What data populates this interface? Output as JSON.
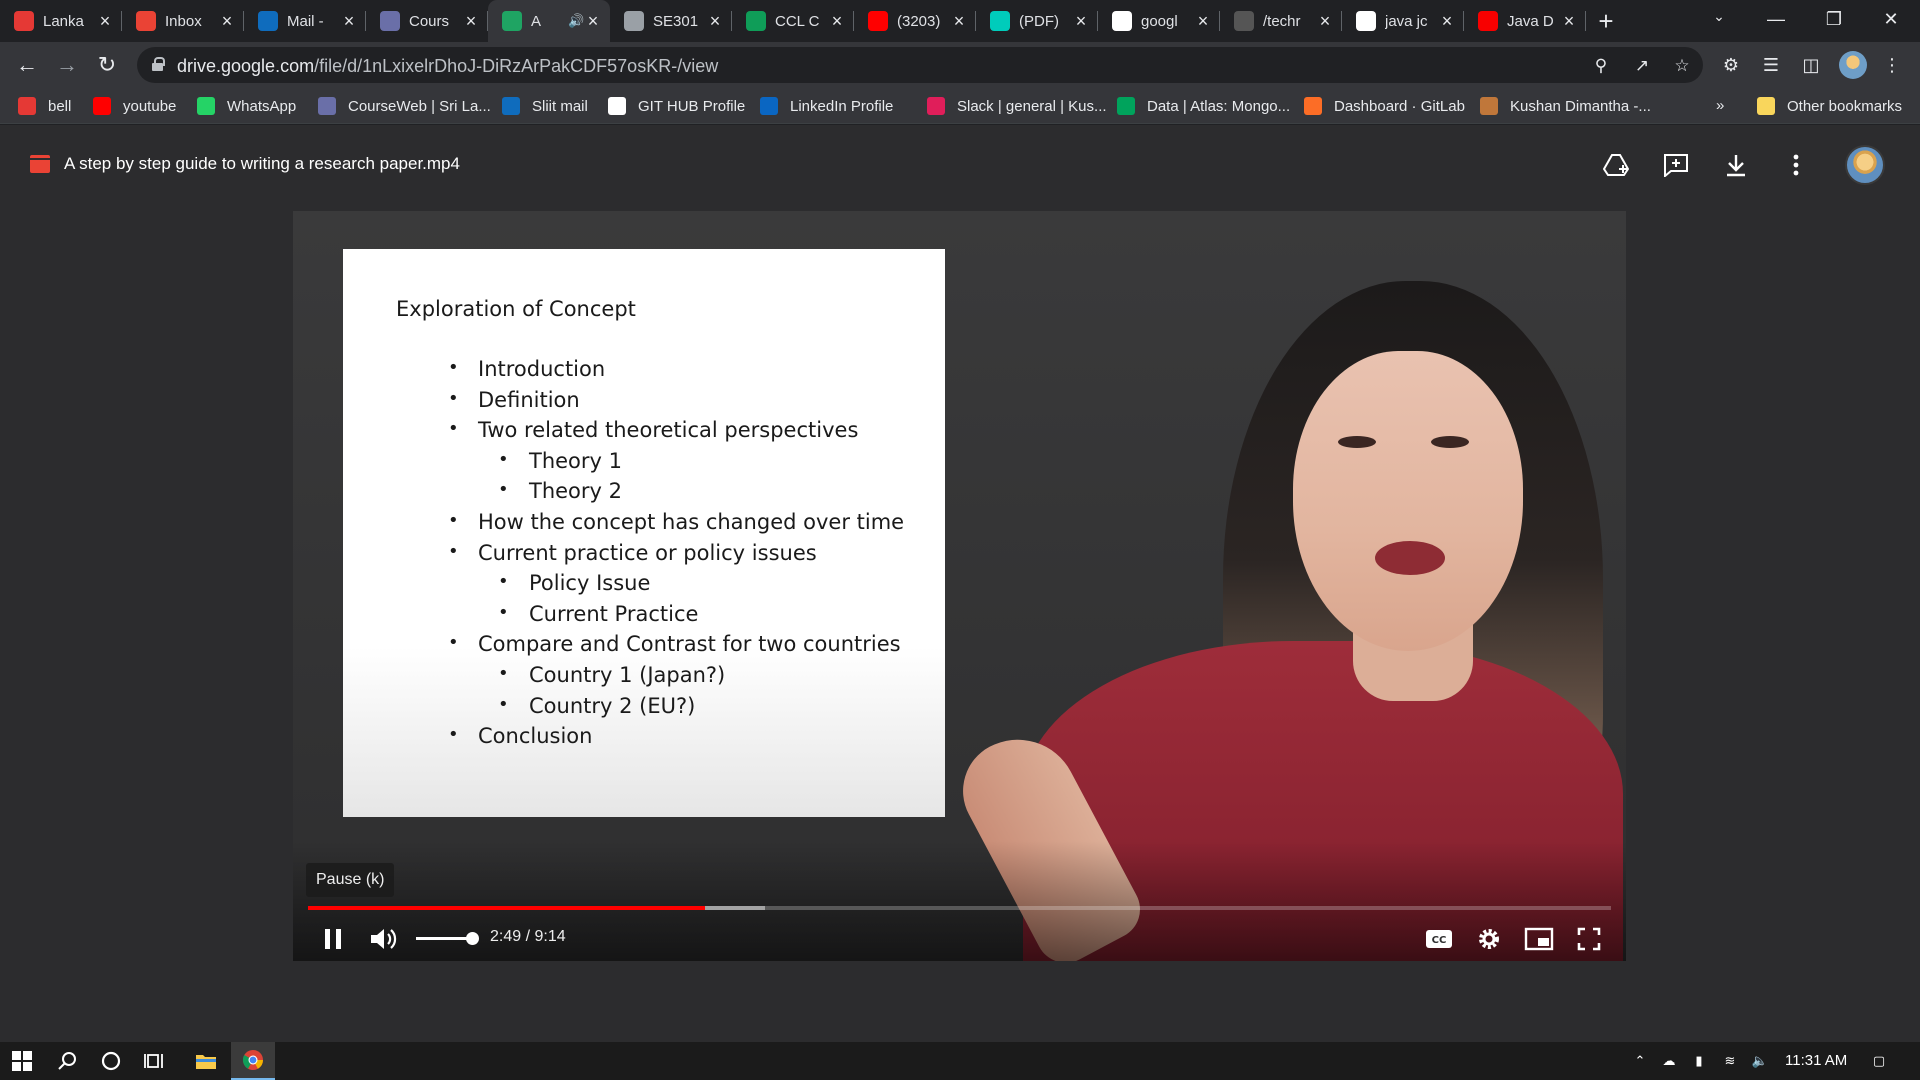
{
  "browser": {
    "tabs": [
      {
        "title": "Lanka",
        "favicon": "lanka-icon",
        "color": "#e53935",
        "active": false
      },
      {
        "title": "Inbox",
        "favicon": "gmail-icon",
        "color": "#ea4335",
        "active": false
      },
      {
        "title": "Mail -",
        "favicon": "outlook-icon",
        "color": "#0f6cbd",
        "active": false
      },
      {
        "title": "Cours",
        "favicon": "courseweb-icon",
        "color": "#6a6fa8",
        "active": false
      },
      {
        "title": "A",
        "favicon": "google-drive-icon",
        "color": "#1fa463",
        "active": true,
        "audio": true
      },
      {
        "title": "SE301",
        "favicon": "globe-icon",
        "color": "#9aa0a6",
        "active": false
      },
      {
        "title": "CCL C",
        "favicon": "sheets-icon",
        "color": "#0f9d58",
        "active": false
      },
      {
        "title": "(3203)",
        "favicon": "youtube-icon",
        "color": "#ff0000",
        "active": false
      },
      {
        "title": "(PDF)",
        "favicon": "researchgate-icon",
        "color": "#00ccbb",
        "active": false
      },
      {
        "title": "googl",
        "favicon": "google-icon",
        "color": "#ffffff",
        "active": false
      },
      {
        "title": "/techr",
        "favicon": "techr-icon",
        "color": "#555555",
        "active": false
      },
      {
        "title": "java jc",
        "favicon": "google-icon",
        "color": "#ffffff",
        "active": false
      },
      {
        "title": "Java D",
        "favicon": "oracle-icon",
        "color": "#f80000",
        "active": false
      }
    ],
    "url_host": "drive.google.com",
    "url_path": "/file/d/1nLxixelrDhoJ-DiRzArPakCDF57osKR-/view",
    "bookmarks": [
      {
        "label": "bell",
        "icon": "lanka-icon",
        "color": "#e53935"
      },
      {
        "label": "youtube",
        "icon": "youtube-icon",
        "color": "#ff0000"
      },
      {
        "label": "WhatsApp",
        "icon": "whatsapp-icon",
        "color": "#25d366"
      },
      {
        "label": "CourseWeb | Sri La...",
        "icon": "courseweb-icon",
        "color": "#6a6fa8"
      },
      {
        "label": "Sliit mail",
        "icon": "outlook-icon",
        "color": "#0f6cbd"
      },
      {
        "label": "GIT HUB Profile",
        "icon": "github-icon",
        "color": "#ffffff"
      },
      {
        "label": "LinkedIn Profile",
        "icon": "linkedin-icon",
        "color": "#0a66c2"
      },
      {
        "label": "Slack | general | Kus...",
        "icon": "slack-icon",
        "color": "#e01e5a"
      },
      {
        "label": "Data | Atlas: Mongo...",
        "icon": "mongodb-icon",
        "color": "#00a35c"
      },
      {
        "label": "Dashboard · GitLab",
        "icon": "gitlab-icon",
        "color": "#fc6d26"
      },
      {
        "label": "Kushan Dimantha -...",
        "icon": "profile-icon",
        "color": "#c0773a"
      }
    ],
    "bookmarks_overflow": "»",
    "other_bookmarks": "Other bookmarks"
  },
  "viewer": {
    "file_title": "A step by step guide to writing a research paper.mp4"
  },
  "video": {
    "slide_title": "Exploration of Concept",
    "slide_items": [
      {
        "level": 1,
        "text": "Introduction"
      },
      {
        "level": 1,
        "text": "Definition"
      },
      {
        "level": 1,
        "text": "Two related theoretical perspectives"
      },
      {
        "level": 2,
        "text": "Theory 1"
      },
      {
        "level": 2,
        "text": "Theory 2"
      },
      {
        "level": 1,
        "text": "How the concept has changed over time"
      },
      {
        "level": 1,
        "text": "Current practice or policy issues"
      },
      {
        "level": 2,
        "text": "Policy Issue"
      },
      {
        "level": 2,
        "text": "Current Practice"
      },
      {
        "level": 1,
        "text": "Compare and Contrast for two countries"
      },
      {
        "level": 2,
        "text": "Country 1 (Japan?)"
      },
      {
        "level": 2,
        "text": "Country 2 (EU?)"
      },
      {
        "level": 1,
        "text": "Conclusion"
      }
    ],
    "tooltip": "Pause (k)",
    "time_display": "2:49 / 9:14",
    "played_fraction": 0.305,
    "buffered_fraction": 0.351,
    "volume_fraction": 1.0,
    "accent": "#ff0000"
  },
  "taskbar": {
    "clock": "11:31 AM"
  }
}
